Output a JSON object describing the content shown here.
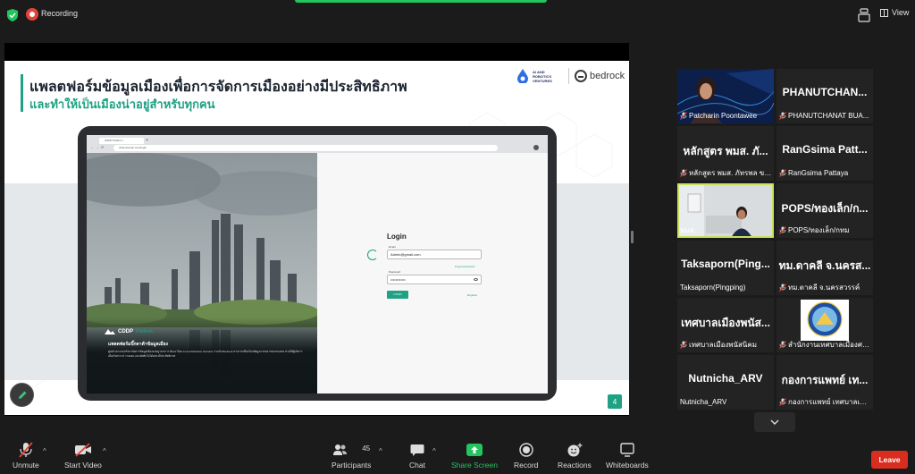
{
  "topbar": {
    "recording_label": "Recording",
    "view_label": "View"
  },
  "slide": {
    "title_line1": "แพลตฟอร์มข้อมูลเมืองเพื่อการจัดการเมืองอย่างมีประสิทธิภาพ",
    "title_line2": "และทำให้เป็นเมืองน่าอยู่สำหรับทุกคน",
    "logo_ai_text": "AI AND ROBOTICS VENTURES",
    "logo_bedrock_text": "bedrock",
    "page_number": "4",
    "browser": {
      "tab_title": "CDDP Platform",
      "address": "cddp.domain.com/login"
    },
    "hero": {
      "brand": "CDDP",
      "brand_sub": "Platform",
      "caption_title": "แพลตฟอร์มบิ๊กดาต้าข้อมูลเมือง",
      "caption_body": "ศูนย์รวมระบบบริหารจัดการข้อมูลเมืองแบบบูรณาการ พัฒนาโดย AI and Robotics Ventures ร่วมกับ Bedrock สามารถเชื่อมโยงข้อมูลจากหลากหลายแหล่ง ช่วยให้ผู้บริหารเมืองวิเคราะห์ วางแผน และตัดสินใจได้อย่างมีประสิทธิภาพ"
    },
    "login": {
      "heading": "Login",
      "email_label": "Email",
      "email_value": "Admin@gmail.com",
      "forgot_label": "Forgot password",
      "password_label": "Password",
      "password_value": "••••••••••••",
      "button_label": "LOGIN",
      "register_label": "Register"
    }
  },
  "participants": [
    {
      "display": "",
      "caption": "Patcharin Poontawee",
      "muted": true,
      "video": true
    },
    {
      "display": "PHANUTCHAN...",
      "caption": "PHANUTCHANAT BUA...",
      "muted": true,
      "video": false
    },
    {
      "display": "หลักสูตร พมส. ภั...",
      "caption": "หลักสูตร พมส. ภัทรพล ขา...",
      "muted": true,
      "video": false
    },
    {
      "display": "RanGsima Patt...",
      "caption": "RanGsima Pattaya",
      "muted": true,
      "video": false
    },
    {
      "display": "",
      "caption": "พมส. ...",
      "muted": false,
      "video": true,
      "active": true
    },
    {
      "display": "POPS/ทองเล็ก/ก...",
      "caption": "POPS/ทองเล็ก/กทม",
      "muted": true,
      "video": false
    },
    {
      "display": "Taksaporn(Ping...",
      "caption": "Taksaporn(Pingping)",
      "muted": false,
      "video": false
    },
    {
      "display": "ทม.ดาคลี จ.นครส...",
      "caption": "ทม.ตาคลี จ.นครสวรรค์",
      "muted": true,
      "video": false
    },
    {
      "display": "เทศบาลเมืองพนัส...",
      "caption": "เทศบาลเมืองพนัสนิคม",
      "muted": true,
      "video": false
    },
    {
      "display": "",
      "caption": "สำนักงานเทศบาลเมืองศรีส...",
      "muted": true,
      "video": false,
      "logo": true
    },
    {
      "display": "Nutnicha_ARV",
      "caption": "Nutnicha_ARV",
      "muted": false,
      "video": false
    },
    {
      "display": "กองการแพทย์ เท...",
      "caption": "กองการแพทย์ เทศบาลเมือ...",
      "muted": true,
      "video": false
    }
  ],
  "toolbar": {
    "unmute": "Unmute",
    "start_video": "Start Video",
    "participants": "Participants",
    "participants_count": "45",
    "chat": "Chat",
    "share_screen": "Share Screen",
    "record": "Record",
    "reactions": "Reactions",
    "whiteboards": "Whiteboards",
    "leave": "Leave"
  },
  "colors": {
    "accent_green": "#1ea184",
    "share_green": "#22c55e",
    "leave_red": "#d92d20",
    "muted_red": "#e0443a",
    "active_outline": "#c8e05c"
  }
}
